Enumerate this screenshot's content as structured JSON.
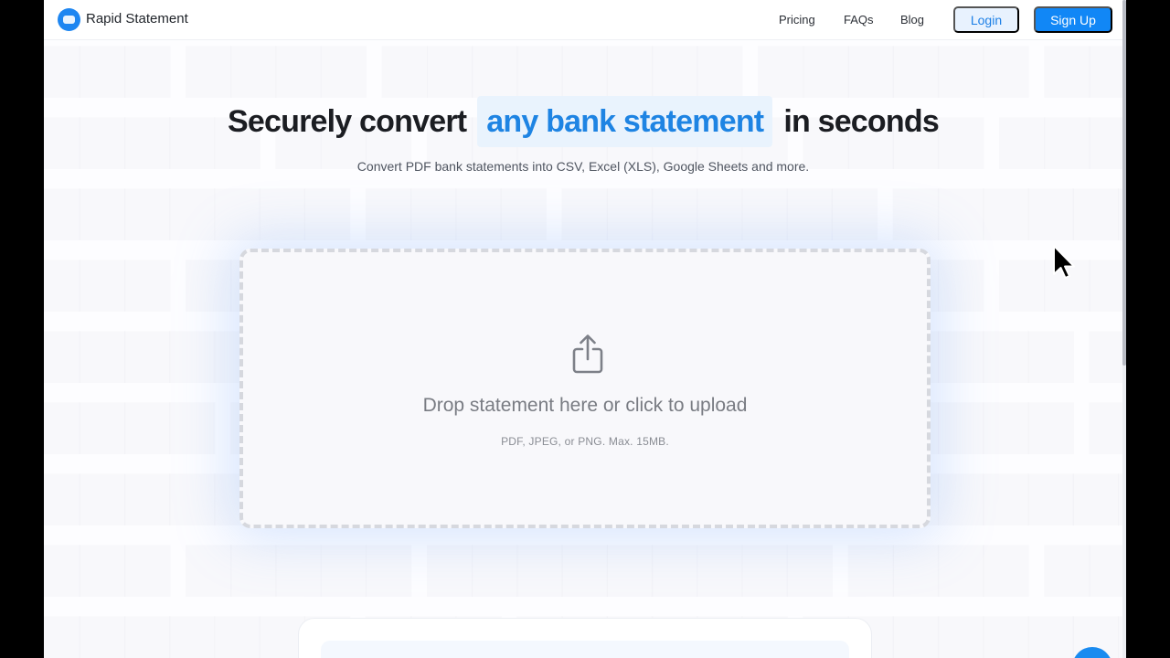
{
  "brand": {
    "name": "Rapid Statement",
    "color": "#1d86f1"
  },
  "nav": {
    "links": [
      {
        "label": "Pricing"
      },
      {
        "label": "FAQs"
      },
      {
        "label": "Blog"
      }
    ],
    "login_label": "Login",
    "signup_label": "Sign Up"
  },
  "hero": {
    "title_before": "Securely convert",
    "title_highlight": "any bank statement",
    "title_after": "in seconds",
    "subtitle": "Convert PDF bank statements into CSV, Excel (XLS), Google Sheets and more."
  },
  "upload": {
    "icon": "share-upload-icon",
    "title": "Drop statement here or click to upload",
    "hint": "PDF, JPEG, or PNG. Max. 15MB."
  },
  "colors": {
    "accent": "#1187f6",
    "highlight_bg": "#e9f3fd",
    "highlight_text": "#1e84e3"
  }
}
